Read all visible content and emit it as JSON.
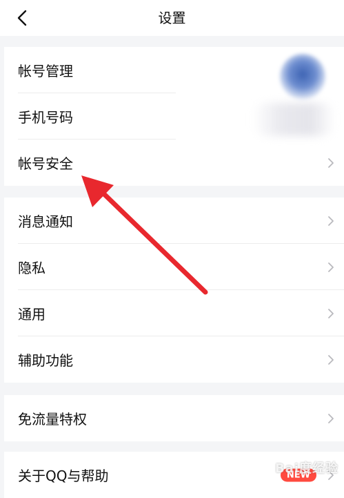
{
  "header": {
    "title": "设置",
    "back_icon": "chevron-left-icon"
  },
  "groups": [
    {
      "items": [
        {
          "label": "帐号管理",
          "has_avatar": true
        },
        {
          "label": "手机号码",
          "has_blur_value": true
        },
        {
          "label": "帐号安全",
          "chevron": true
        }
      ]
    },
    {
      "items": [
        {
          "label": "消息通知",
          "chevron": true
        },
        {
          "label": "隐私",
          "chevron": true
        },
        {
          "label": "通用",
          "chevron": true
        },
        {
          "label": "辅助功能",
          "chevron": true
        }
      ]
    },
    {
      "items": [
        {
          "label": "免流量特权",
          "chevron": true
        }
      ]
    },
    {
      "items": [
        {
          "label": "关于QQ与帮助",
          "badge": "NEW",
          "chevron": true
        }
      ]
    }
  ],
  "colors": {
    "background": "#f4f5f7",
    "arrow": "#e8282e",
    "badge": "#ff4a3f"
  },
  "watermark": "Bai度经验"
}
